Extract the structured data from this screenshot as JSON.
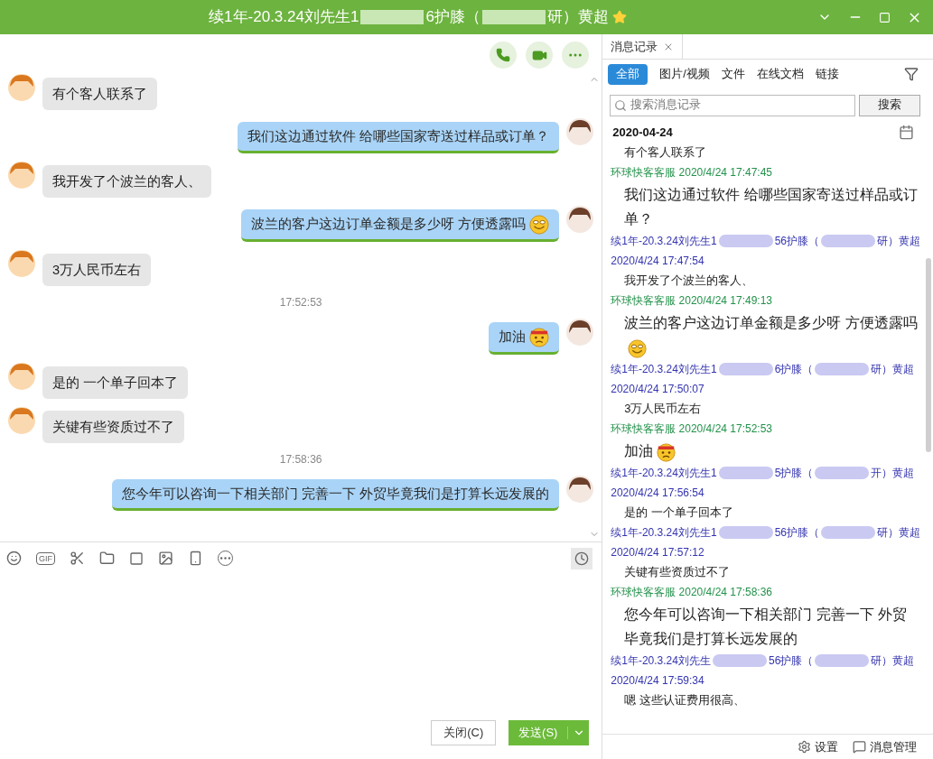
{
  "window": {
    "title_parts": [
      "续1年-20.3.24刘先生1",
      "6护膝（",
      "研）黄超"
    ]
  },
  "chat": [
    {
      "kind": "received",
      "text": "有个客人联系了"
    },
    {
      "kind": "sent",
      "text": "我们这边通过软件  给哪些国家寄送过样品或订单？"
    },
    {
      "kind": "received",
      "text": "我开发了个波兰的客人、"
    },
    {
      "kind": "sent",
      "text": "波兰的客户这边订单金额是多少呀   方便透露吗",
      "emoji": {
        "kind": "grin"
      }
    },
    {
      "kind": "received",
      "text": "3万人民币左右"
    },
    {
      "kind": "time",
      "text": "17:52:53"
    },
    {
      "kind": "sent",
      "text": "加油",
      "emoji": {
        "kind": "angry"
      }
    },
    {
      "kind": "received",
      "text": "是的  一个单子回本了"
    },
    {
      "kind": "received",
      "text": "关键有些资质过不了"
    },
    {
      "kind": "time",
      "text": "17:58:36"
    },
    {
      "kind": "sent",
      "text": "您今年可以咨询一下相关部门  完善一下  外贸毕竟我们是打算长远发展的"
    }
  ],
  "toolbar": {
    "gif_label": "GIF"
  },
  "buttons": {
    "close": "关闭(C)",
    "send": "发送(S)"
  },
  "history_panel": {
    "tab": "消息记录",
    "filters": [
      {
        "label": "全部",
        "selected": true
      },
      {
        "label": "图片/视频",
        "selected": false
      },
      {
        "label": "文件",
        "selected": false
      },
      {
        "label": "在线文档",
        "selected": false
      },
      {
        "label": "链接",
        "selected": false
      }
    ],
    "search": {
      "placeholder": "搜索消息记录",
      "button": "搜索"
    },
    "date": "2020-04-24",
    "entries": [
      {
        "kind": "peer",
        "text": "有个客人联系了"
      },
      {
        "kind": "self",
        "sender": "环球快客客服",
        "time": "2020/4/24 17:47:45",
        "text": "我们这边通过软件  给哪些国家寄送过样品或订单？"
      },
      {
        "kind": "peer",
        "sender_parts": [
          "续1年-20.3.24刘先生1",
          "56护膝（",
          "研）黄超"
        ],
        "time": "2020/4/24 17:47:54",
        "text": "我开发了个波兰的客人、"
      },
      {
        "kind": "self",
        "sender": "环球快客客服",
        "time": "2020/4/24 17:49:13",
        "text": "波兰的客户这边订单金额是多少呀   方便透露吗",
        "emoji": {
          "kind": "grin"
        }
      },
      {
        "kind": "peer",
        "sender_parts": [
          "续1年-20.3.24刘先生1",
          "6护膝（",
          "研）黄超"
        ],
        "time": "2020/4/24 17:50:07",
        "text": "3万人民币左右"
      },
      {
        "kind": "self",
        "sender": "环球快客客服",
        "time": "2020/4/24 17:52:53",
        "text": "加油",
        "emoji": {
          "kind": "angry"
        }
      },
      {
        "kind": "peer",
        "sender_parts": [
          "续1年-20.3.24刘先生1",
          "5护膝（",
          "开）黄超"
        ],
        "time": "2020/4/24 17:56:54",
        "text": "是的  一个单子回本了"
      },
      {
        "kind": "peer",
        "sender_parts": [
          "续1年-20.3.24刘先生1",
          "56护膝（",
          "研）黄超"
        ],
        "time": "2020/4/24 17:57:12",
        "text": "关键有些资质过不了"
      },
      {
        "kind": "self",
        "sender": "环球快客客服",
        "time": "2020/4/24 17:58:36",
        "text": "您今年可以咨询一下相关部门  完善一下  外贸毕竟我们是打算长远发展的"
      },
      {
        "kind": "peer",
        "sender_parts": [
          "续1年-20.3.24刘先生",
          "56护膝（",
          "研）黄超"
        ],
        "time": "2020/4/24 17:59:34",
        "text": "嗯  这些认证费用很高、"
      }
    ],
    "footer": {
      "settings": "设置",
      "manage": "消息管理"
    }
  }
}
